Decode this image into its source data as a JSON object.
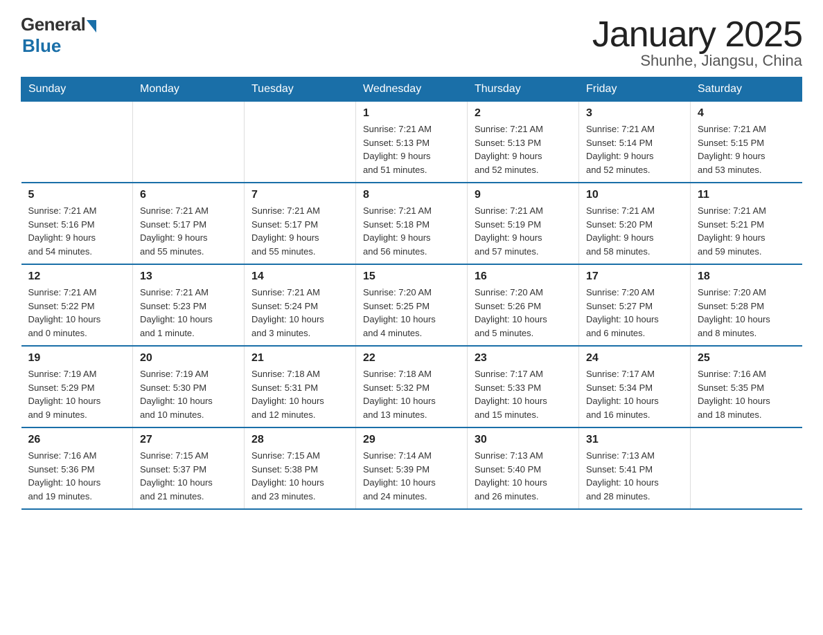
{
  "header": {
    "logo_general": "General",
    "logo_blue": "Blue",
    "month_title": "January 2025",
    "location": "Shunhe, Jiangsu, China"
  },
  "weekdays": [
    "Sunday",
    "Monday",
    "Tuesday",
    "Wednesday",
    "Thursday",
    "Friday",
    "Saturday"
  ],
  "weeks": [
    [
      {
        "day": "",
        "info": ""
      },
      {
        "day": "",
        "info": ""
      },
      {
        "day": "",
        "info": ""
      },
      {
        "day": "1",
        "info": "Sunrise: 7:21 AM\nSunset: 5:13 PM\nDaylight: 9 hours\nand 51 minutes."
      },
      {
        "day": "2",
        "info": "Sunrise: 7:21 AM\nSunset: 5:13 PM\nDaylight: 9 hours\nand 52 minutes."
      },
      {
        "day": "3",
        "info": "Sunrise: 7:21 AM\nSunset: 5:14 PM\nDaylight: 9 hours\nand 52 minutes."
      },
      {
        "day": "4",
        "info": "Sunrise: 7:21 AM\nSunset: 5:15 PM\nDaylight: 9 hours\nand 53 minutes."
      }
    ],
    [
      {
        "day": "5",
        "info": "Sunrise: 7:21 AM\nSunset: 5:16 PM\nDaylight: 9 hours\nand 54 minutes."
      },
      {
        "day": "6",
        "info": "Sunrise: 7:21 AM\nSunset: 5:17 PM\nDaylight: 9 hours\nand 55 minutes."
      },
      {
        "day": "7",
        "info": "Sunrise: 7:21 AM\nSunset: 5:17 PM\nDaylight: 9 hours\nand 55 minutes."
      },
      {
        "day": "8",
        "info": "Sunrise: 7:21 AM\nSunset: 5:18 PM\nDaylight: 9 hours\nand 56 minutes."
      },
      {
        "day": "9",
        "info": "Sunrise: 7:21 AM\nSunset: 5:19 PM\nDaylight: 9 hours\nand 57 minutes."
      },
      {
        "day": "10",
        "info": "Sunrise: 7:21 AM\nSunset: 5:20 PM\nDaylight: 9 hours\nand 58 minutes."
      },
      {
        "day": "11",
        "info": "Sunrise: 7:21 AM\nSunset: 5:21 PM\nDaylight: 9 hours\nand 59 minutes."
      }
    ],
    [
      {
        "day": "12",
        "info": "Sunrise: 7:21 AM\nSunset: 5:22 PM\nDaylight: 10 hours\nand 0 minutes."
      },
      {
        "day": "13",
        "info": "Sunrise: 7:21 AM\nSunset: 5:23 PM\nDaylight: 10 hours\nand 1 minute."
      },
      {
        "day": "14",
        "info": "Sunrise: 7:21 AM\nSunset: 5:24 PM\nDaylight: 10 hours\nand 3 minutes."
      },
      {
        "day": "15",
        "info": "Sunrise: 7:20 AM\nSunset: 5:25 PM\nDaylight: 10 hours\nand 4 minutes."
      },
      {
        "day": "16",
        "info": "Sunrise: 7:20 AM\nSunset: 5:26 PM\nDaylight: 10 hours\nand 5 minutes."
      },
      {
        "day": "17",
        "info": "Sunrise: 7:20 AM\nSunset: 5:27 PM\nDaylight: 10 hours\nand 6 minutes."
      },
      {
        "day": "18",
        "info": "Sunrise: 7:20 AM\nSunset: 5:28 PM\nDaylight: 10 hours\nand 8 minutes."
      }
    ],
    [
      {
        "day": "19",
        "info": "Sunrise: 7:19 AM\nSunset: 5:29 PM\nDaylight: 10 hours\nand 9 minutes."
      },
      {
        "day": "20",
        "info": "Sunrise: 7:19 AM\nSunset: 5:30 PM\nDaylight: 10 hours\nand 10 minutes."
      },
      {
        "day": "21",
        "info": "Sunrise: 7:18 AM\nSunset: 5:31 PM\nDaylight: 10 hours\nand 12 minutes."
      },
      {
        "day": "22",
        "info": "Sunrise: 7:18 AM\nSunset: 5:32 PM\nDaylight: 10 hours\nand 13 minutes."
      },
      {
        "day": "23",
        "info": "Sunrise: 7:17 AM\nSunset: 5:33 PM\nDaylight: 10 hours\nand 15 minutes."
      },
      {
        "day": "24",
        "info": "Sunrise: 7:17 AM\nSunset: 5:34 PM\nDaylight: 10 hours\nand 16 minutes."
      },
      {
        "day": "25",
        "info": "Sunrise: 7:16 AM\nSunset: 5:35 PM\nDaylight: 10 hours\nand 18 minutes."
      }
    ],
    [
      {
        "day": "26",
        "info": "Sunrise: 7:16 AM\nSunset: 5:36 PM\nDaylight: 10 hours\nand 19 minutes."
      },
      {
        "day": "27",
        "info": "Sunrise: 7:15 AM\nSunset: 5:37 PM\nDaylight: 10 hours\nand 21 minutes."
      },
      {
        "day": "28",
        "info": "Sunrise: 7:15 AM\nSunset: 5:38 PM\nDaylight: 10 hours\nand 23 minutes."
      },
      {
        "day": "29",
        "info": "Sunrise: 7:14 AM\nSunset: 5:39 PM\nDaylight: 10 hours\nand 24 minutes."
      },
      {
        "day": "30",
        "info": "Sunrise: 7:13 AM\nSunset: 5:40 PM\nDaylight: 10 hours\nand 26 minutes."
      },
      {
        "day": "31",
        "info": "Sunrise: 7:13 AM\nSunset: 5:41 PM\nDaylight: 10 hours\nand 28 minutes."
      },
      {
        "day": "",
        "info": ""
      }
    ]
  ]
}
